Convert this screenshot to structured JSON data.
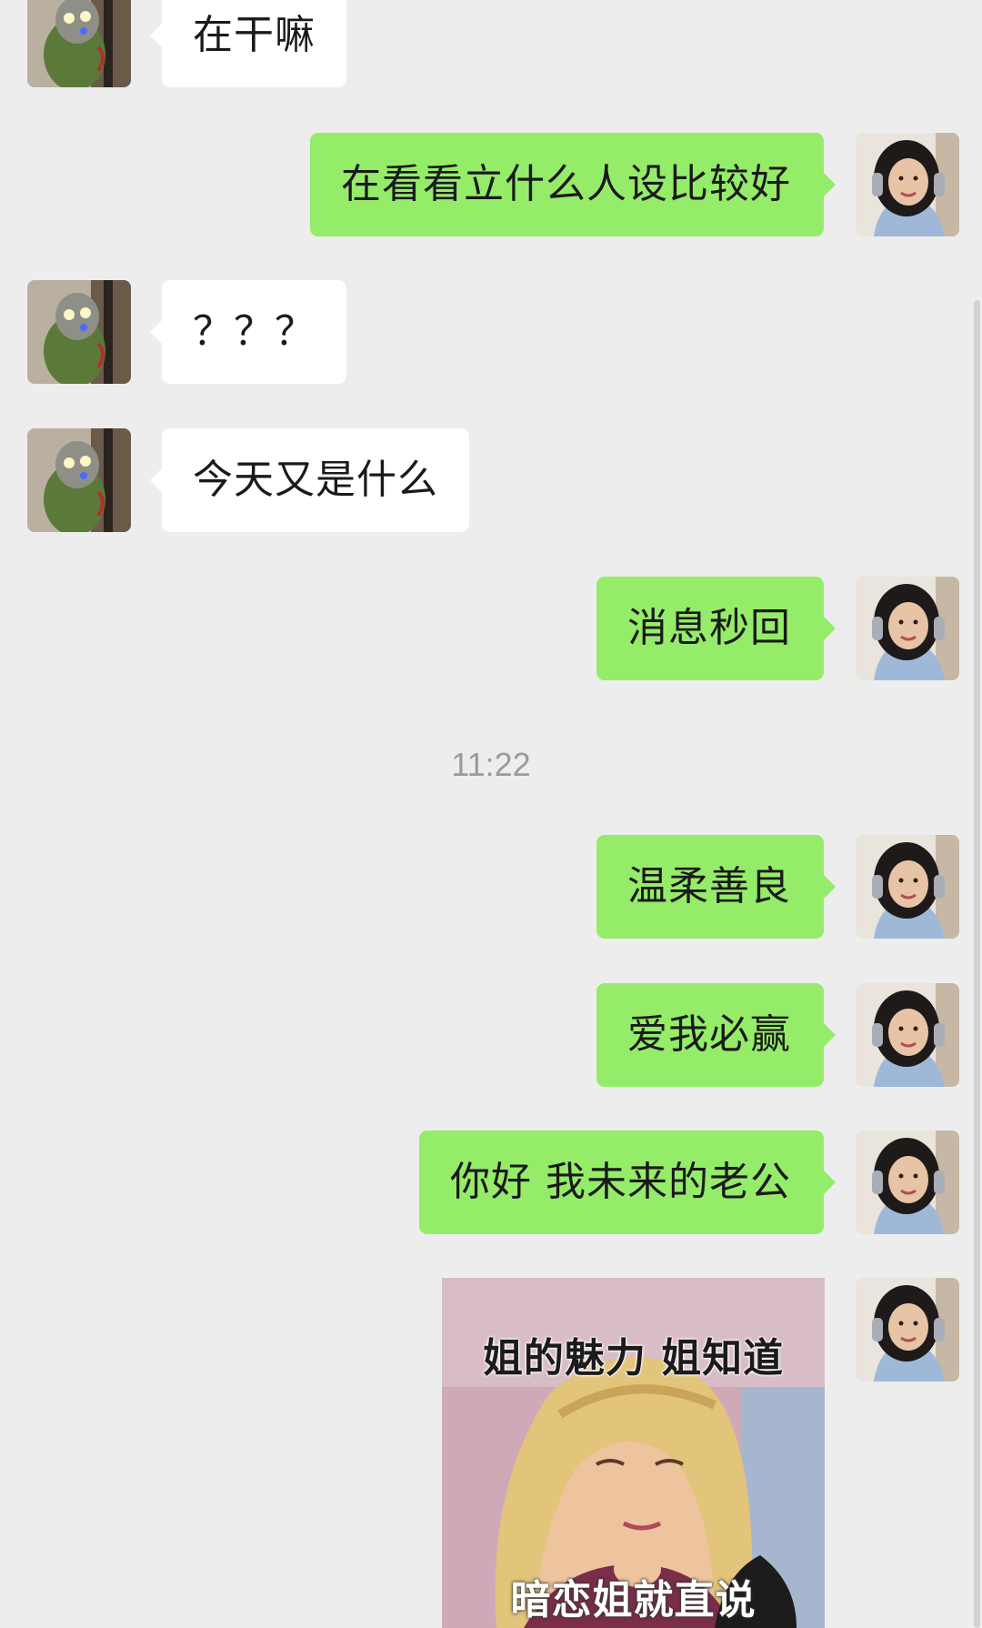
{
  "colors": {
    "background": "#ededed",
    "incoming_bubble": "#ffffff",
    "outgoing_bubble": "#95ec69",
    "timestamp_text": "#9b9b9b"
  },
  "messages": [
    {
      "sender": "contact",
      "text": "在干嘛"
    },
    {
      "sender": "me",
      "text": "在看看立什么人设比较好"
    },
    {
      "sender": "contact",
      "text": "？？？"
    },
    {
      "sender": "contact",
      "text": "今天又是什么"
    },
    {
      "sender": "me",
      "text": "消息秒回"
    },
    {
      "sender": "me",
      "text": "温柔善良"
    },
    {
      "sender": "me",
      "text": "爱我必赢"
    },
    {
      "sender": "me",
      "text": "你好 我未来的老公"
    }
  ],
  "timestamp": "11:22",
  "sticker": {
    "caption_top": "姐的魅力 姐知道",
    "caption_bottom": "暗恋姐就直说"
  },
  "icons": {
    "contact_avatar": "ultraman-avatar",
    "my_avatar": "girl-headphones-avatar"
  }
}
